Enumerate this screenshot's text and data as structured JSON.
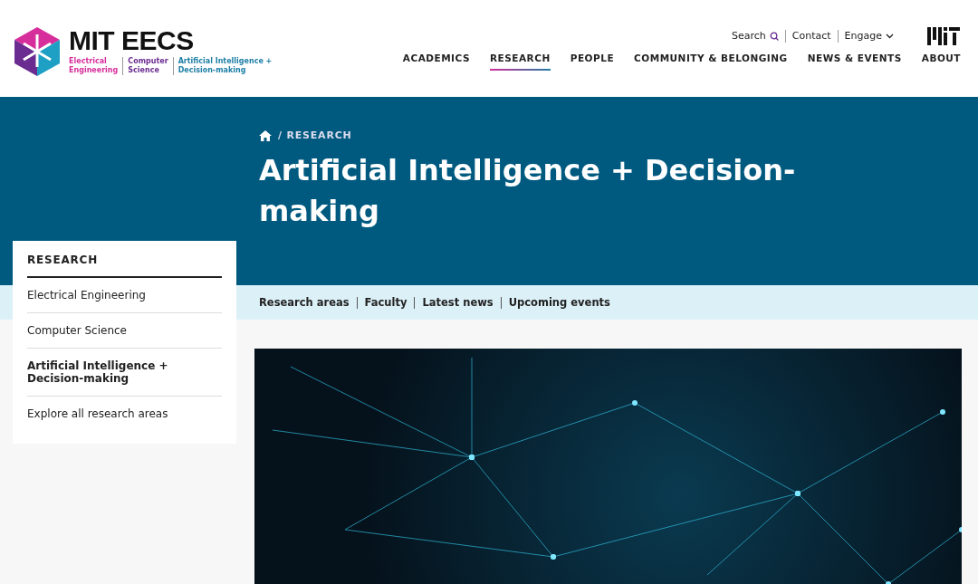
{
  "logo": {
    "wordmark": "MIT EECS",
    "units": [
      {
        "label": "Electrical\nEngineering",
        "color": "#d62e9b"
      },
      {
        "label": "Computer\nScience",
        "color": "#6b2c91"
      },
      {
        "label": "Artificial Intelligence +\nDecision-making",
        "color": "#1e7fa6"
      }
    ]
  },
  "utility_nav": [
    {
      "label": "Search",
      "kind": "search"
    },
    {
      "label": "Contact",
      "kind": "link"
    },
    {
      "label": "Engage",
      "kind": "dropdown"
    }
  ],
  "main_nav": [
    {
      "label": "ACADEMICS",
      "selected": false
    },
    {
      "label": "RESEARCH",
      "selected": true
    },
    {
      "label": "PEOPLE",
      "selected": false
    },
    {
      "label": "COMMUNITY & BELONGING",
      "selected": false
    },
    {
      "label": "NEWS & EVENTS",
      "selected": false
    },
    {
      "label": "ABOUT",
      "selected": false
    }
  ],
  "breadcrumb": [
    "/ RESEARCH"
  ],
  "page_title": "Artificial Intelligence + Decision-making",
  "sub_nav": [
    "Research areas",
    "Faculty",
    "Latest news",
    "Upcoming events"
  ],
  "sidebar": {
    "heading": "RESEARCH",
    "items": [
      {
        "label": "Electrical Engineering",
        "selected": false
      },
      {
        "label": "Computer Science",
        "selected": false
      },
      {
        "label": "Artificial Intelligence + Decision-making",
        "selected": true
      },
      {
        "label": "Explore all research areas",
        "selected": false
      }
    ]
  }
}
